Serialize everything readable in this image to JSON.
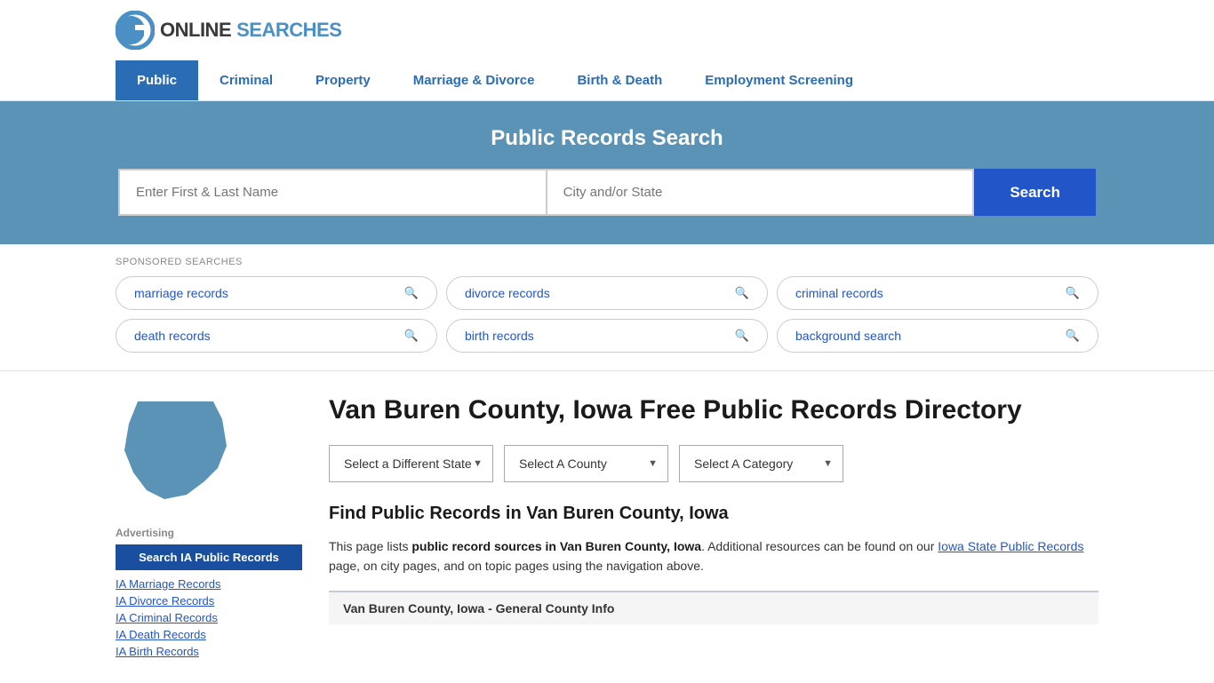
{
  "header": {
    "logo_online": "ONLINE",
    "logo_searches": "SEARCHES"
  },
  "nav": {
    "items": [
      {
        "label": "Public",
        "active": true
      },
      {
        "label": "Criminal",
        "active": false
      },
      {
        "label": "Property",
        "active": false
      },
      {
        "label": "Marriage & Divorce",
        "active": false
      },
      {
        "label": "Birth & Death",
        "active": false
      },
      {
        "label": "Employment Screening",
        "active": false
      }
    ]
  },
  "hero": {
    "title": "Public Records Search",
    "input1_placeholder": "Enter First & Last Name",
    "input2_placeholder": "City and/or State",
    "search_button": "Search"
  },
  "sponsored": {
    "label": "SPONSORED SEARCHES",
    "items": [
      "marriage records",
      "divorce records",
      "criminal records",
      "death records",
      "birth records",
      "background search"
    ]
  },
  "sidebar": {
    "ads_label": "Advertising",
    "primary_btn": "Search IA Public Records",
    "links": [
      "IA Marriage Records",
      "IA Divorce Records",
      "IA Criminal Records",
      "IA Death Records",
      "IA Birth Records"
    ]
  },
  "content": {
    "page_title": "Van Buren County, Iowa Free Public Records Directory",
    "dropdowns": {
      "state": "Select a Different State",
      "county": "Select A County",
      "category": "Select A Category"
    },
    "section_title": "Find Public Records in Van Buren County, Iowa",
    "description": "This page lists ",
    "bold1": "public record sources in Van Buren County, Iowa",
    "desc_mid": ". Additional resources can be found on our ",
    "link_text": "Iowa State Public Records",
    "desc_end": " page, on city pages, and on topic pages using the navigation above.",
    "county_info_bar": "Van Buren County, Iowa - General County Info"
  }
}
